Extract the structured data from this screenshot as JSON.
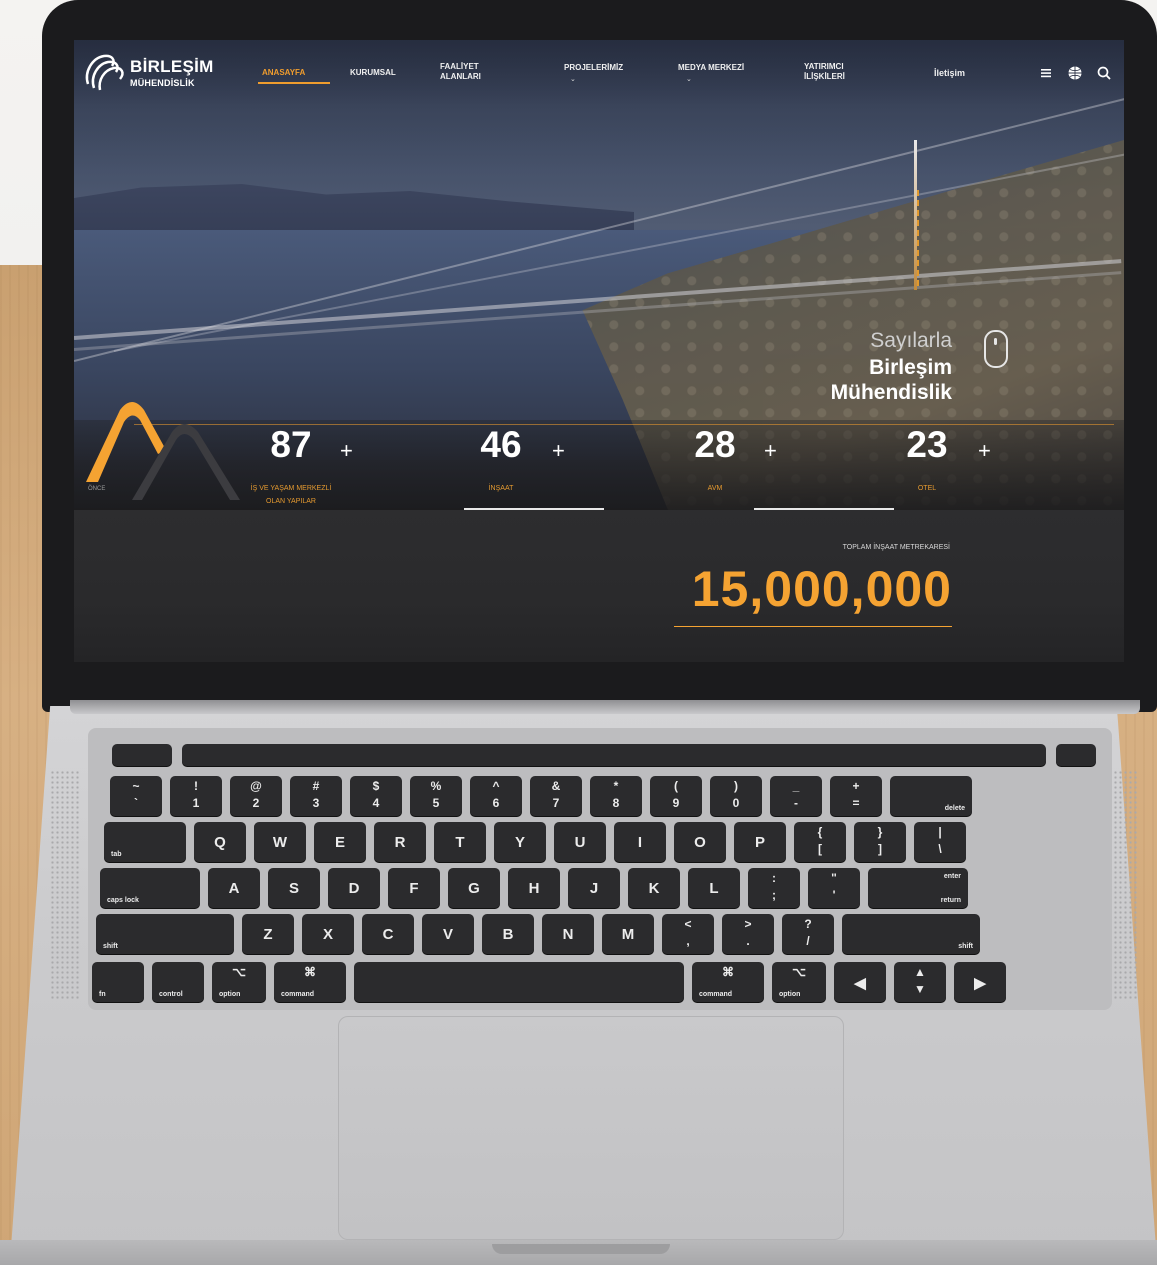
{
  "logo": {
    "name": "BİRLEŞİM",
    "sub": "MÜHENDİSLİK"
  },
  "nav": {
    "items": [
      {
        "label": "ANASAYFA",
        "active": true
      },
      {
        "label": "KURUMSAL"
      },
      {
        "label": "FAALİYET\nALANLARI"
      },
      {
        "label": "PROJELERİMİZ"
      },
      {
        "label": "MEDYA MERKEZİ"
      },
      {
        "label": "YATIRIMCI\nİLİŞKİLERİ"
      },
      {
        "label": "İletişim"
      }
    ],
    "icons": [
      "menu-icon",
      "globe-icon",
      "search-icon"
    ]
  },
  "hero": {
    "line1": "Sayılarla",
    "line2": "Birleşim",
    "line3": "Mühendislik"
  },
  "stats": [
    {
      "value": "87",
      "suffix": "+",
      "label": "İŞ VE YAŞAM MERKEZLİ\nOLAN YAPILAR"
    },
    {
      "value": "46",
      "suffix": "+",
      "label": "İNŞAAT"
    },
    {
      "value": "28",
      "suffix": "+",
      "label": "AVM"
    },
    {
      "value": "23",
      "suffix": "+",
      "label": "OTEL"
    }
  ],
  "stats_arrow_label": "ÖNCE",
  "total": {
    "label": "TOPLAM İNŞAAT METREKARESİ",
    "value": "15,000,000"
  },
  "keyboard": {
    "rows": [
      [
        {
          "top": "~",
          "bot": "`"
        },
        {
          "top": "!",
          "bot": "1"
        },
        {
          "top": "@",
          "bot": "2"
        },
        {
          "top": "#",
          "bot": "3"
        },
        {
          "top": "$",
          "bot": "4"
        },
        {
          "top": "%",
          "bot": "5"
        },
        {
          "top": "^",
          "bot": "6"
        },
        {
          "top": "&",
          "bot": "7"
        },
        {
          "top": "*",
          "bot": "8"
        },
        {
          "top": "(",
          "bot": "9"
        },
        {
          "top": ")",
          "bot": "0"
        },
        {
          "top": "_",
          "bot": "-"
        },
        {
          "top": "+",
          "bot": "="
        },
        {
          "corner_r": "delete"
        }
      ],
      [
        {
          "corner": "tab"
        },
        {
          "main": "Q"
        },
        {
          "main": "W"
        },
        {
          "main": "E"
        },
        {
          "main": "R"
        },
        {
          "main": "T"
        },
        {
          "main": "Y"
        },
        {
          "main": "U"
        },
        {
          "main": "I"
        },
        {
          "main": "O"
        },
        {
          "main": "P"
        },
        {
          "top": "{",
          "bot": "["
        },
        {
          "top": "}",
          "bot": "]"
        },
        {
          "top": "|",
          "bot": "\\"
        }
      ],
      [
        {
          "corner": "caps lock"
        },
        {
          "main": "A"
        },
        {
          "main": "S"
        },
        {
          "main": "D"
        },
        {
          "main": "F"
        },
        {
          "main": "G"
        },
        {
          "main": "H"
        },
        {
          "main": "J"
        },
        {
          "main": "K"
        },
        {
          "main": "L"
        },
        {
          "top": ":",
          "bot": ";"
        },
        {
          "top": "\"",
          "bot": "'"
        },
        {
          "corner_tr": "enter",
          "corner_r": "return"
        }
      ],
      [
        {
          "corner": "shift"
        },
        {
          "main": "Z"
        },
        {
          "main": "X"
        },
        {
          "main": "C"
        },
        {
          "main": "V"
        },
        {
          "main": "B"
        },
        {
          "main": "N"
        },
        {
          "main": "M"
        },
        {
          "top": "<",
          "bot": ","
        },
        {
          "top": ">",
          "bot": "."
        },
        {
          "top": "?",
          "bot": "/"
        },
        {
          "corner_r": "shift"
        }
      ],
      [
        {
          "corner": "fn"
        },
        {
          "corner": "control"
        },
        {
          "corner": "option",
          "top": "⌥"
        },
        {
          "corner": "command",
          "top": "⌘"
        },
        {
          "main": ""
        },
        {
          "corner": "command",
          "top": "⌘"
        },
        {
          "corner": "option",
          "top": "⌥"
        },
        {
          "main": "◀"
        },
        {
          "top": "▲",
          "bot": "▼"
        },
        {
          "main": "▶"
        }
      ]
    ]
  },
  "colors": {
    "accent": "#f5a332",
    "nav_active": "#f09d2e",
    "panel": "#2b2b2d",
    "key": "#2b2b2d",
    "aluminium": "#cbcbcd"
  }
}
